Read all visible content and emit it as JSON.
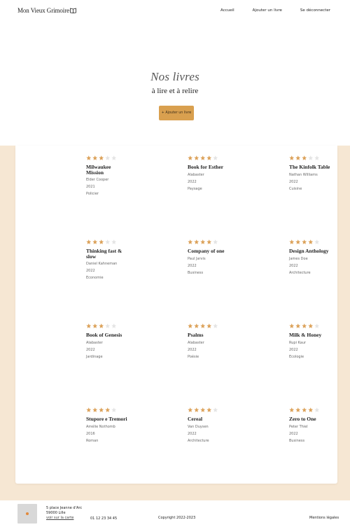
{
  "header": {
    "logo": "Mon Vieux Grimoire",
    "nav": [
      "Accueil",
      "Ajouter un livre",
      "Se déconnecter"
    ]
  },
  "hero": {
    "title": "Nos livres",
    "subtitle": "à lire et à relire",
    "add_button": "+ Ajouter un livre"
  },
  "colors": {
    "accent": "#d9a04f",
    "beige": "#f6e7d3",
    "star_filled": "#dca25a",
    "star_empty": "#e4e4e4"
  },
  "books": [
    {
      "title": "Milwaukee Mission",
      "author": "Elder Cooper",
      "year": "2021",
      "genre": "Policier",
      "rating": 3
    },
    {
      "title": "Book for Esther",
      "author": "Alabaster",
      "year": "2022",
      "genre": "Paysage",
      "rating": 4
    },
    {
      "title": "The Kinfolk Table",
      "author": "Nathan Williams",
      "year": "2022",
      "genre": "Cuisine",
      "rating": 3
    },
    {
      "title": "Thinking fast & slow",
      "author": "Daniel Kahneman",
      "year": "2022",
      "genre": "Economie",
      "rating": 3
    },
    {
      "title": "Company of one",
      "author": "Paul Jarvis",
      "year": "2022",
      "genre": "Business",
      "rating": 4
    },
    {
      "title": "Design Anthology",
      "author": "James Doe",
      "year": "2022",
      "genre": "Architecture",
      "rating": 4
    },
    {
      "title": "Book of Genesis",
      "author": "Alabaster",
      "year": "2022",
      "genre": "Jardinage",
      "rating": 3
    },
    {
      "title": "Psalms",
      "author": "Alabaster",
      "year": "2022",
      "genre": "Poésie",
      "rating": 4
    },
    {
      "title": "Milk & Honey",
      "author": "Rupi Kaur",
      "year": "2022",
      "genre": "Ecologie",
      "rating": 4
    },
    {
      "title": "Stupore e Tremori",
      "author": "Amélie Nothomb",
      "year": "2016",
      "genre": "Roman",
      "rating": 4
    },
    {
      "title": "Cereal",
      "author": "Van Duysen",
      "year": "2022",
      "genre": "Architecture",
      "rating": 4
    },
    {
      "title": "Zero to One",
      "author": "Peter Thiel",
      "year": "2022",
      "genre": "Business",
      "rating": 4
    }
  ],
  "footer": {
    "address_line1": "5 place Jeanne d'Arc",
    "address_line2": "59000 Lille",
    "map_link": "voir sur la carte",
    "phone": "01 12 23 34 45",
    "copyright": "Copyright 2022-2023",
    "legal": "Mentions légales"
  }
}
